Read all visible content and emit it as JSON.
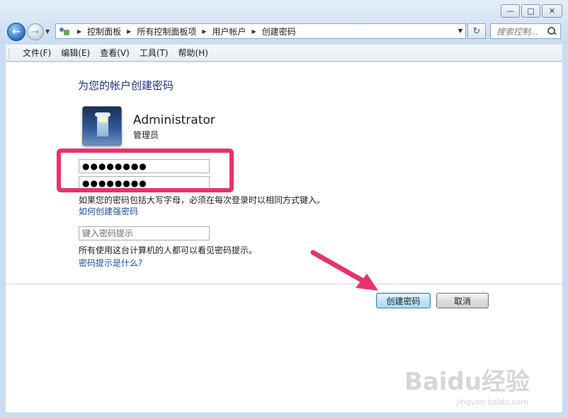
{
  "window": {
    "minimize_icon": "minimize-icon",
    "maximize_icon": "maximize-icon",
    "close_icon": "close-icon"
  },
  "nav": {
    "breadcrumbs": [
      "控制面板",
      "所有控制面板项",
      "用户帐户",
      "创建密码"
    ],
    "search_placeholder": "搜索控制...",
    "back_icon": "back-arrow-icon",
    "forward_icon": "forward-arrow-icon",
    "refresh_icon": "refresh-icon",
    "search_icon": "search-icon"
  },
  "menu": {
    "items": [
      "文件(F)",
      "编辑(E)",
      "查看(V)",
      "工具(T)",
      "帮助(H)"
    ]
  },
  "main": {
    "title": "为您的帐户创建密码",
    "user_name": "Administrator",
    "user_role": "管理员",
    "password_value": "●●●●●●●●",
    "confirm_value": "●●●●●●●●",
    "case_note": "如果您的密码包括大写字母，必须在每次登录时以相同方式键入。",
    "strong_pw_link": "如何创建强密码",
    "hint_placeholder": "键入密码提示",
    "hint_note": "所有使用这台计算机的人都可以看见密码提示。",
    "hint_link": "密码提示是什么?",
    "create_button": "创建密码",
    "cancel_button": "取消"
  },
  "annotation": {
    "highlight_color": "#e8326a",
    "arrow_color": "#e8326a"
  },
  "watermark": {
    "brand": "Baidu经验",
    "sub": "jingyan.baidu.com"
  }
}
